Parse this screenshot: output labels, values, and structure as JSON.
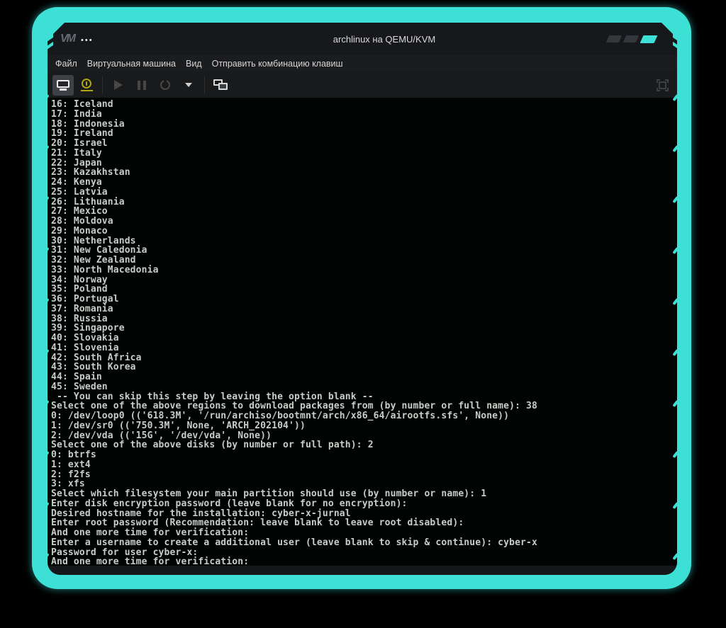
{
  "colors": {
    "accent": "#3de0d5",
    "details_icon_yellow": "#b3a512",
    "terminal_foreground": "#c7cec8",
    "terminal_background": "#020303"
  },
  "window": {
    "titlebar": {
      "logo": "VM",
      "dots": "•••",
      "title": "archlinux на QEMU/KVM"
    },
    "menubar": [
      "Файл",
      "Виртуальная машина",
      "Вид",
      "Отправить комбинацию клавиш"
    ],
    "toolbar_icons": [
      "console-monitor-icon",
      "vm-details-icon",
      "play-icon",
      "pause-icon",
      "power-icon",
      "chevron-down-icon",
      "virtual-displays-icon",
      "fullscreen-icon"
    ]
  },
  "terminal": {
    "lines": [
      "16: Iceland",
      "17: India",
      "18: Indonesia",
      "19: Ireland",
      "20: Israel",
      "21: Italy",
      "22: Japan",
      "23: Kazakhstan",
      "24: Kenya",
      "25: Latvia",
      "26: Lithuania",
      "27: Mexico",
      "28: Moldova",
      "29: Monaco",
      "30: Netherlands",
      "31: New Caledonia",
      "32: New Zealand",
      "33: North Macedonia",
      "34: Norway",
      "35: Poland",
      "36: Portugal",
      "37: Romania",
      "38: Russia",
      "39: Singapore",
      "40: Slovakia",
      "41: Slovenia",
      "42: South Africa",
      "43: South Korea",
      "44: Spain",
      "45: Sweden",
      " -- You can skip this step by leaving the option blank --",
      "Select one of the above regions to download packages from (by number or full name): 38",
      "0: /dev/loop0 (('618.3M', '/run/archiso/bootmnt/arch/x86_64/airootfs.sfs', None))",
      "1: /dev/sr0 (('750.3M', None, 'ARCH_202104'))",
      "2: /dev/vda (('15G', '/dev/vda', None))",
      "Select one of the above disks (by number or full path): 2",
      "0: btrfs",
      "1: ext4",
      "2: f2fs",
      "3: xfs",
      "Select which filesystem your main partition should use (by number or name): 1",
      "Enter disk encryption password (leave blank for no encryption):",
      "Desired hostname for the installation: cyber-x-jurnal",
      "Enter root password (Recommendation: leave blank to leave root disabled):",
      "And one more time for verification:",
      "Enter a username to create a additional user (leave blank to skip & continue): cyber-x",
      "Password for user cyber-x:",
      "And one more time for verification:"
    ]
  }
}
